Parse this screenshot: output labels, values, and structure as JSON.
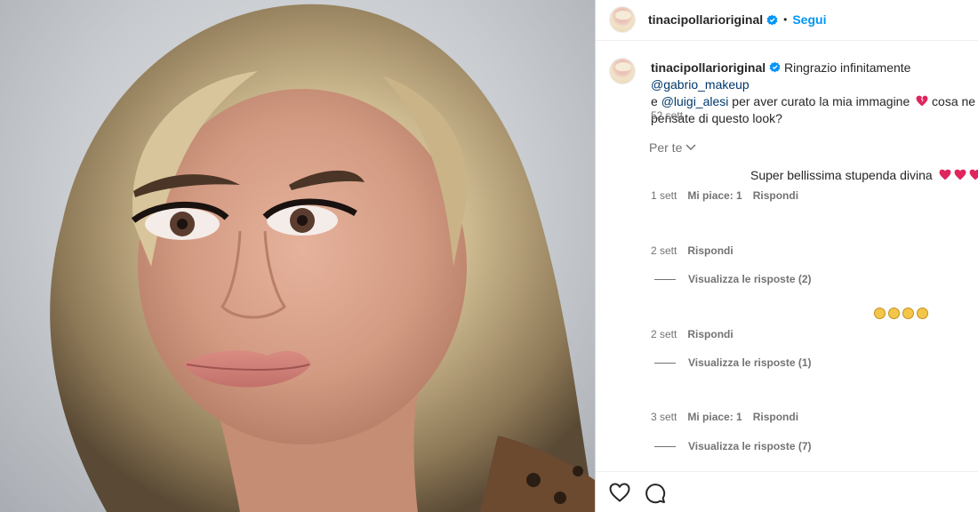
{
  "post": {
    "username": "tinacipollarioriginal",
    "follow_label": "Segui",
    "separator": "•"
  },
  "caption": {
    "username": "tinacipollarioriginal",
    "text_1": " Ringrazio infinitamente ",
    "mention_1": "@gabrio_makeup",
    "text_2": "e ",
    "mention_2": "@luigi_alesi",
    "text_3": " per aver curato la mia immagine ",
    "text_4": " cosa ne pensate di questo look?",
    "time": "52 sett"
  },
  "sort_label": "Per te",
  "comments": [
    {
      "text": "Super bellissima stupenda divina",
      "time": "1 sett",
      "likes": "Mi piace: 1",
      "reply": "Rispondi"
    },
    {
      "text": "",
      "time": "2 sett",
      "reply": "Rispondi",
      "view_replies": "Visualizza le risposte (2)"
    },
    {
      "text": "",
      "time": "2 sett",
      "reply": "Rispondi",
      "view_replies": "Visualizza le risposte (1)"
    },
    {
      "text": "",
      "time": "3 sett",
      "likes": "Mi piace: 1",
      "reply": "Rispondi",
      "view_replies": "Visualizza le risposte (7)"
    }
  ],
  "icons": {
    "verified": "verified-badge-icon",
    "like": "heart-outline-icon",
    "comment": "speech-bubble-icon",
    "sort": "chevron-down-icon"
  },
  "colors": {
    "accent": "#0095f6",
    "mention": "#00376b",
    "muted": "#737373",
    "heart_emoji": "#e0245e"
  }
}
